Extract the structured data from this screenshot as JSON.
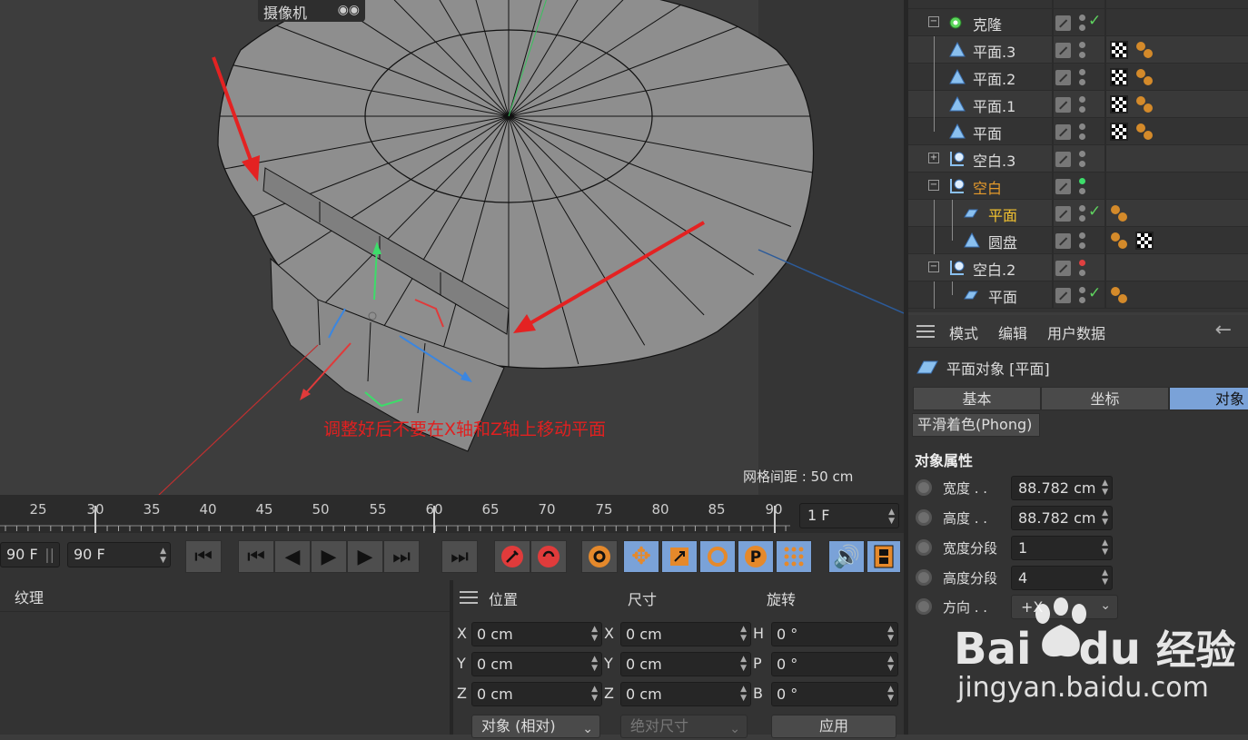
{
  "viewport": {
    "camera_label": "摄像机",
    "grid_spacing": "网格间距 : 50 cm",
    "annotation": "调整好后不要在X轴和Z轴上移动平面"
  },
  "object_manager": {
    "rows": [
      {
        "label": "克隆",
        "icon": "cloner-icon",
        "style": "normal"
      },
      {
        "label": "平面.3",
        "icon": "polygon-object-icon",
        "style": "normal"
      },
      {
        "label": "平面.2",
        "icon": "polygon-object-icon",
        "style": "normal"
      },
      {
        "label": "平面.1",
        "icon": "polygon-object-icon",
        "style": "normal"
      },
      {
        "label": "平面",
        "icon": "polygon-object-icon",
        "style": "normal"
      },
      {
        "label": "空白.3",
        "icon": "null-object-icon",
        "style": "normal"
      },
      {
        "label": "空白",
        "icon": "null-object-icon",
        "style": "orange"
      },
      {
        "label": "平面",
        "icon": "plane-icon",
        "style": "yellow"
      },
      {
        "label": "圆盘",
        "icon": "polygon-object-icon",
        "style": "normal"
      },
      {
        "label": "空白.2",
        "icon": "null-object-icon",
        "style": "normal"
      },
      {
        "label": "平面",
        "icon": "plane-icon",
        "style": "normal"
      }
    ]
  },
  "attributes": {
    "menu": [
      "模式",
      "编辑",
      "用户数据"
    ],
    "object_title": "平面对象 [平面]",
    "tabs": [
      "基本",
      "坐标",
      "对象"
    ],
    "active_tab": "对象",
    "subtab": "平滑着色(Phong)",
    "section_title": "对象属性",
    "properties": [
      {
        "label": "宽度 . .",
        "value": "88.782 cm"
      },
      {
        "label": "高度 . .",
        "value": "88.782 cm"
      },
      {
        "label": "宽度分段",
        "value": "1"
      },
      {
        "label": "高度分段",
        "value": "4"
      }
    ],
    "orientation_label": "方向 . .",
    "orientation_value": "+X"
  },
  "timeline": {
    "ticks": [
      "25",
      "30",
      "35",
      "40",
      "45",
      "50",
      "55",
      "60",
      "65",
      "70",
      "75",
      "80",
      "85",
      "90"
    ],
    "current_frame": "1 F"
  },
  "transport": {
    "start_field": "90 F",
    "end_field": "90 F"
  },
  "material_panel": {
    "label": "纹理"
  },
  "coordinates": {
    "headers": [
      "位置",
      "尺寸",
      "旋转"
    ],
    "rows": [
      {
        "pos_axis": "X",
        "pos": "0 cm",
        "size_axis": "X",
        "size": "0 cm",
        "rot_axis": "H",
        "rot": "0 °"
      },
      {
        "pos_axis": "Y",
        "pos": "0 cm",
        "size_axis": "Y",
        "size": "0 cm",
        "rot_axis": "P",
        "rot": "0 °"
      },
      {
        "pos_axis": "Z",
        "pos": "0 cm",
        "size_axis": "Z",
        "size": "0 cm",
        "rot_axis": "B",
        "rot": "0 °"
      }
    ],
    "mode_select": "对象 (相对)",
    "size_select": "绝对尺寸",
    "apply_button": "应用"
  },
  "watermark": {
    "brand": "Bai",
    "brand_suffix": "du",
    "product": "经验",
    "url": "jingyan.baidu.com"
  }
}
